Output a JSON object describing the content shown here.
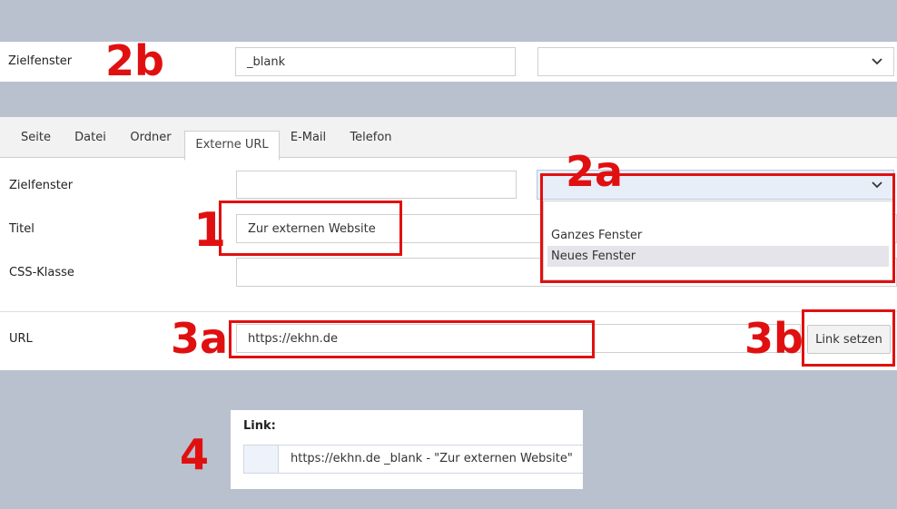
{
  "top_strip": {
    "label": "Zielfenster",
    "value": "_blank",
    "annotation": "2b"
  },
  "tabs": [
    {
      "label": "Seite"
    },
    {
      "label": "Datei"
    },
    {
      "label": "Ordner"
    },
    {
      "label": "Externe URL"
    },
    {
      "label": "E-Mail"
    },
    {
      "label": "Telefon"
    }
  ],
  "form": {
    "zielfenster_label": "Zielfenster",
    "titel_label": "Titel",
    "titel_value": "Zur externen Website",
    "css_label": "CSS-Klasse",
    "url_label": "URL",
    "url_value": "https://ekhn.de",
    "link_button": "Link setzen"
  },
  "dropdown": {
    "options": [
      "Ganzes Fenster",
      "Neues Fenster"
    ]
  },
  "result": {
    "heading": "Link:",
    "value": "https://ekhn.de _blank - \"Zur externen Website\""
  },
  "annotations": {
    "a1": "1",
    "a2a": "2a",
    "a2b": "2b",
    "a3a": "3a",
    "a3b": "3b",
    "a4": "4"
  },
  "colors": {
    "annotation_red": "#e01010",
    "background": "#b9c1cf"
  }
}
